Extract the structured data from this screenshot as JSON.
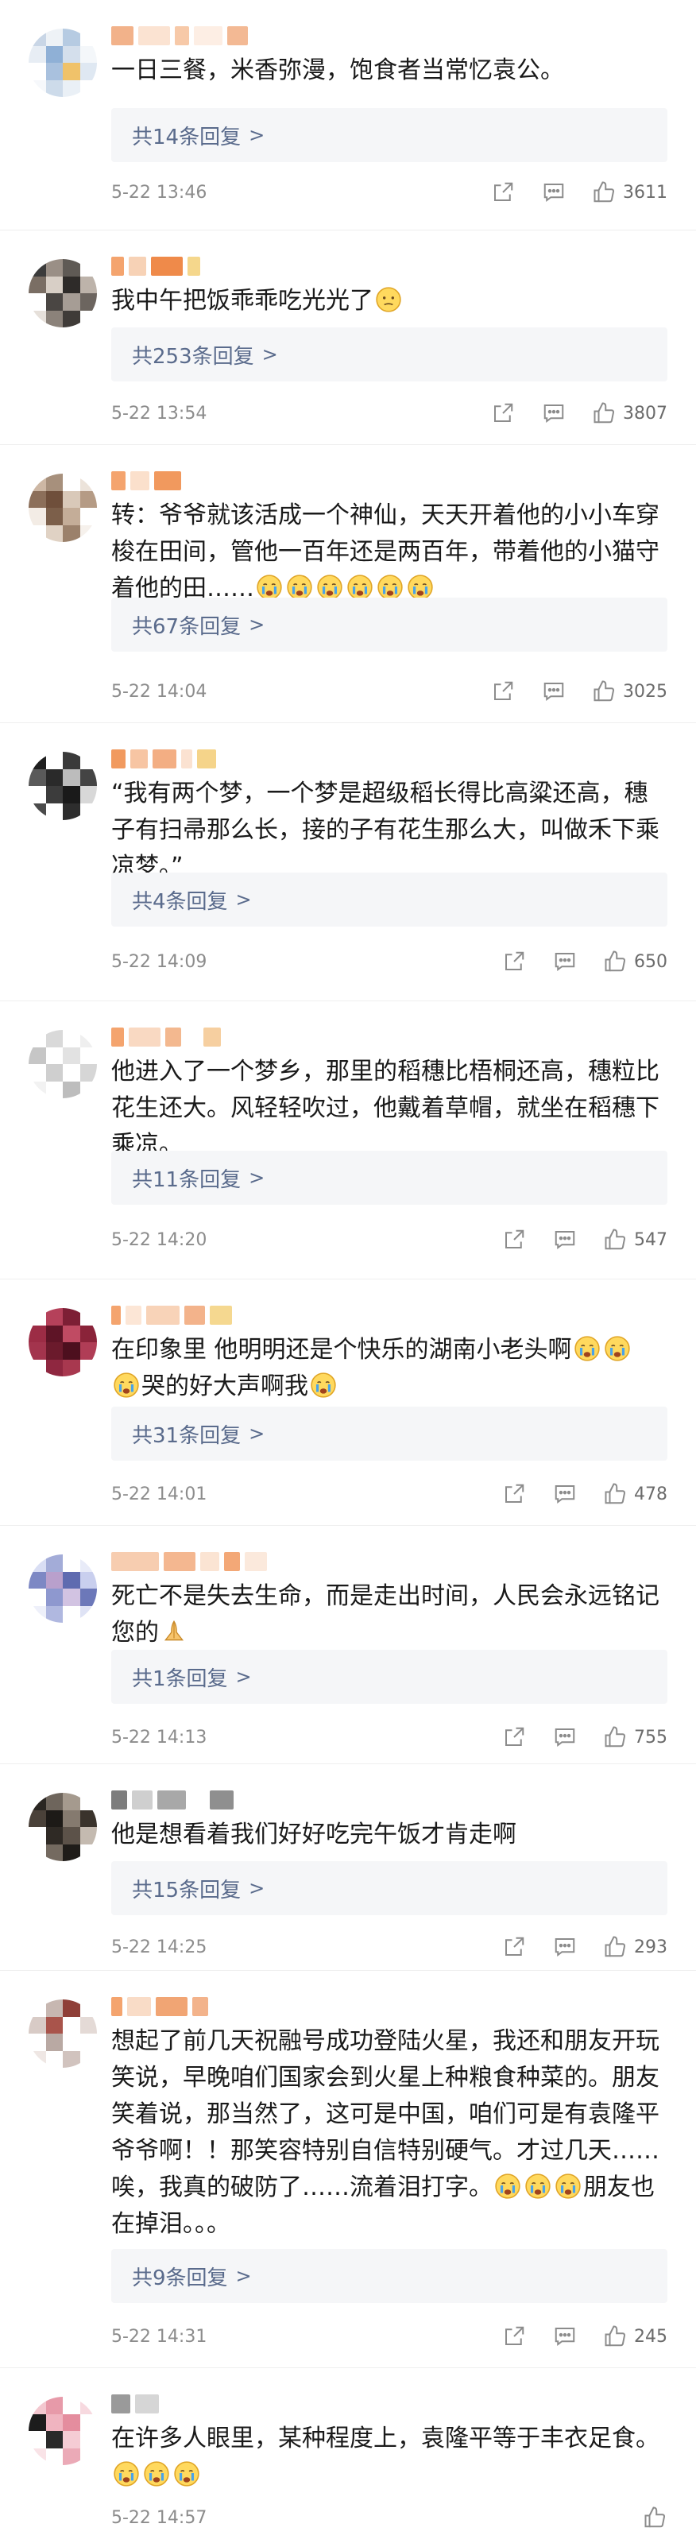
{
  "colors": {
    "reply_box_bg": "#f5f6f8",
    "reply_text": "#5a6b8c",
    "meta_text": "#8c8c8c"
  },
  "comments": [
    {
      "text": "一日三餐，米香弥漫，饱食者当常忆袁公。",
      "replies": "共14条回复",
      "time": "5-22 13:46",
      "likes": "3611",
      "emojis": []
    },
    {
      "text": "我中午把饭乖乖吃光光了",
      "replies": "共253条回复",
      "time": "5-22 13:54",
      "likes": "3807",
      "emojis": [
        "sweat-smile-emoji"
      ]
    },
    {
      "text": "转：爷爷就该活成一个神仙，天天开着他的小小车穿梭在田间，管他一百年还是两百年，带着他的小猫守着他的田……",
      "replies": "共67条回复",
      "time": "5-22 14:04",
      "likes": "3025",
      "emojis": [
        "crying-emoji",
        "crying-emoji",
        "crying-emoji",
        "crying-emoji",
        "crying-emoji",
        "crying-emoji"
      ]
    },
    {
      "text": "“我有两个梦，一个梦是超级稻长得比高粱还高，穗子有扫帚那么长，接的子有花生那么大，叫做禾下乘凉梦。”",
      "replies": "共4条回复",
      "time": "5-22 14:09",
      "likes": "650",
      "emojis": []
    },
    {
      "text": "他进入了一个梦乡，那里的稻穗比梧桐还高，穗粒比花生还大。风轻轻吹过，他戴着草帽，就坐在稻穗下乘凉。",
      "replies": "共11条回复",
      "time": "5-22 14:20",
      "likes": "547",
      "emojis": []
    },
    {
      "text": "在印象里 他明明还是个快乐的湖南小老头啊",
      "text2": "哭的好大声啊我",
      "replies": "共31条回复",
      "time": "5-22 14:01",
      "likes": "478",
      "emojis": [
        "crying-emoji",
        "crying-emoji"
      ]
    },
    {
      "text": "死亡不是失去生命，而是走出时间，人民会永远铭记您的",
      "replies": "共1条回复",
      "time": "5-22 14:13",
      "likes": "755",
      "emojis": [
        "praying-hands-emoji"
      ]
    },
    {
      "text": "他是想看着我们好好吃完午饭才肯走啊",
      "replies": "共15条回复",
      "time": "5-22 14:25",
      "likes": "293",
      "emojis": []
    },
    {
      "text": "想起了前几天祝融号成功登陆火星，我还和朋友开玩笑说，早晚咱们国家会到火星上种粮食种菜的。朋友笑着说，那当然了，这可是中国，咱们可是有袁隆平爷爷啊！！那笑容特别自信特别硬气。才过几天……唉，我真的破防了……流着泪打字。",
      "text2": "朋友也在掉泪。。。",
      "replies": "共9条回复",
      "time": "5-22 14:31",
      "likes": "245",
      "emojis": [
        "crying-emoji",
        "crying-emoji",
        "crying-emoji"
      ]
    },
    {
      "text": "在许多人眼里，某种程度上，袁隆平等于丰衣足食。",
      "replies": "",
      "time": "5-22 14:57",
      "likes": "",
      "emojis": [
        "crying-emoji",
        "crying-emoji",
        "crying-emoji"
      ]
    }
  ]
}
